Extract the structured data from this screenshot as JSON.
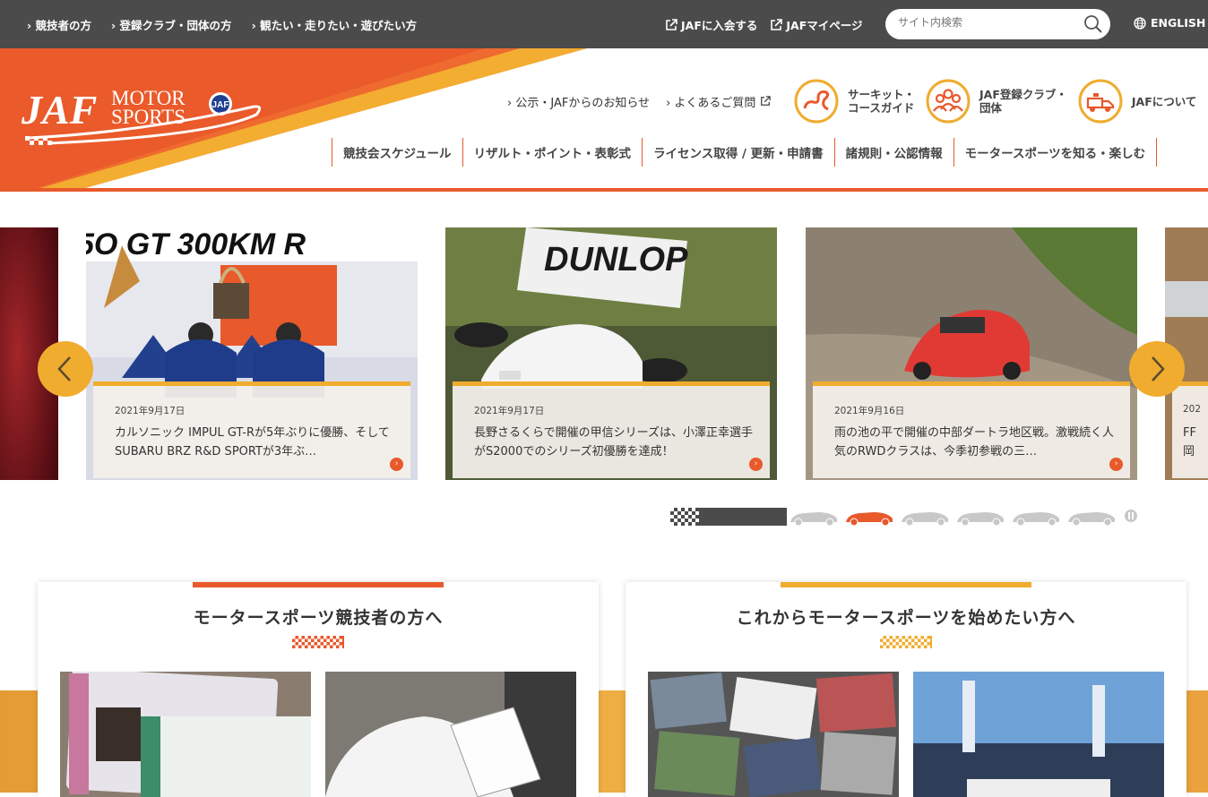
{
  "topbar": {
    "links": [
      "競技者の方",
      "登録クラブ・団体の方",
      "観たい・走りたい・遊びたい方"
    ],
    "external": [
      "JAFに入会する",
      "JAFマイページ"
    ],
    "search_placeholder": "サイト内検索",
    "language": "ENGLISH"
  },
  "header": {
    "logo_text": "JAF MOTOR SPORTS",
    "subnav": [
      "公示・JAFからのお知らせ",
      "よくあるご質問"
    ],
    "guides": [
      {
        "line1": "サーキット・",
        "line2": "コースガイド",
        "icon": "circuit-map-icon"
      },
      {
        "line1": "JAF登録クラブ・",
        "line2": "団体",
        "icon": "people-group-icon"
      },
      {
        "line1": "JAFについて",
        "line2": "",
        "icon": "tow-truck-icon"
      }
    ],
    "mainnav": [
      "競技会スケジュール",
      "リザルト・ポイント・表彰式",
      "ライセンス取得 / 更新・申請書",
      "諸規則・公認情報",
      "モータースポーツを知る・楽しむ"
    ]
  },
  "carousel": {
    "slides": [
      {
        "date": "2021年9月17日",
        "title": "カルソニック IMPUL GT-Rが5年ぶりに優勝、そしてSUBARU BRZ R&D SPORTが3年ぶ…"
      },
      {
        "date": "2021年9月17日",
        "title": "長野さるくらで開催の甲信シリーズは、小澤正幸選手がS2000でのシリーズ初優勝を達成！"
      },
      {
        "date": "2021年9月16日",
        "title": "雨の池の平で開催の中部ダートラ地区戦。激戦続く人気のRWDクラスは、今季初参戦の三…"
      }
    ],
    "partial_right": {
      "date": "202",
      "title": "FF 岡"
    },
    "pager": {
      "count": 6,
      "active": 1
    }
  },
  "sections": [
    {
      "title": "モータースポーツ競技者の方へ",
      "accent": "#e8592b"
    },
    {
      "title": "これからモータースポーツを始めたい方へ",
      "accent": "#f0ac2f"
    }
  ],
  "colors": {
    "orange": "#e8592b",
    "yellow": "#f0ac2f",
    "topbar": "#4b4b4b"
  }
}
